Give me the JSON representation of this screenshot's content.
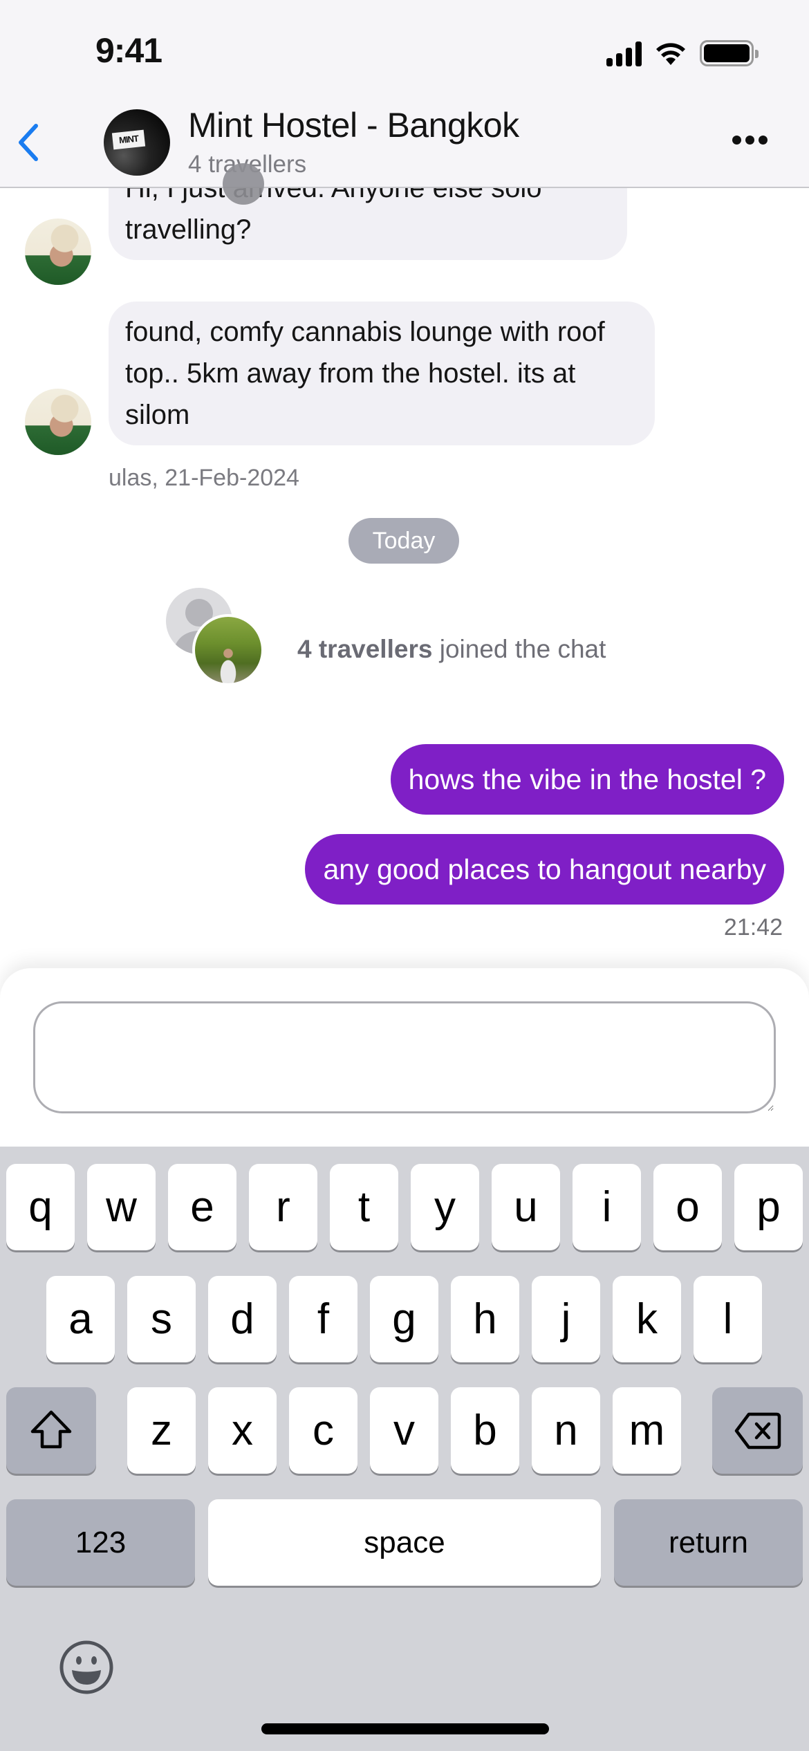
{
  "status_bar": {
    "time": "9:41"
  },
  "header": {
    "back_icon": "chevron-left-icon",
    "avatar_label": "MINT",
    "title": "Mint Hostel - Bangkok",
    "subtitle": "4 travellers",
    "more_icon": "ellipsis-icon"
  },
  "messages": {
    "incoming": [
      {
        "text": "Hi, I just arrived. Anyone else solo travelling?"
      },
      {
        "text": "found, comfy cannabis lounge with roof top.. 5km away from the hostel. its at silom"
      }
    ],
    "incoming_meta": "ulas, 21-Feb-2024",
    "date_separator": "Today",
    "joined": {
      "count_label": "4 travellers",
      "action": "joined the chat"
    },
    "outgoing": [
      {
        "text": "hows the vibe in the hostel ?"
      },
      {
        "text": "any good places to hangout nearby"
      }
    ],
    "outgoing_time": "21:42"
  },
  "composer": {
    "value": "",
    "placeholder": ""
  },
  "keyboard": {
    "row1": [
      "q",
      "w",
      "e",
      "r",
      "t",
      "y",
      "u",
      "i",
      "o",
      "p"
    ],
    "row2": [
      "a",
      "s",
      "d",
      "f",
      "g",
      "h",
      "j",
      "k",
      "l"
    ],
    "row3": [
      "z",
      "x",
      "c",
      "v",
      "b",
      "n",
      "m"
    ],
    "numbers_label": "123",
    "space_label": "space",
    "return_label": "return",
    "shift_icon": "shift-icon",
    "delete_icon": "backspace-icon",
    "emoji_icon": "emoji-icon"
  },
  "colors": {
    "accent": "#7f1fc6",
    "back_chevron": "#1a7cf0",
    "incoming_bubble": "#f1f0f5",
    "date_pill": "#a9abb6",
    "keyboard_bg": "#d2d3d8"
  }
}
